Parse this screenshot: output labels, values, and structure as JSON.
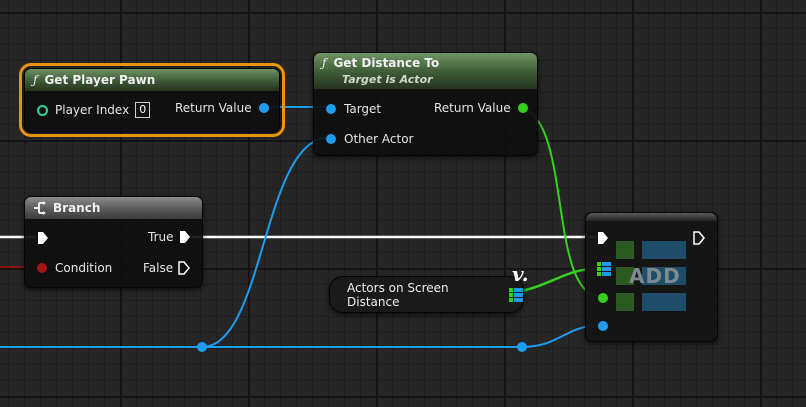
{
  "nodes": {
    "get_player_pawn": {
      "icon": "function-icon",
      "title": "Get Player Pawn",
      "input_label": "Player Index",
      "input_value": "0",
      "output_label": "Return Value"
    },
    "get_distance_to": {
      "icon": "function-icon",
      "title": "Get Distance To",
      "subtitle": "Target is Actor",
      "input_target": "Target",
      "input_other": "Other Actor",
      "output_label": "Return Value"
    },
    "branch": {
      "icon": "branch-icon",
      "title": "Branch",
      "input_condition": "Condition",
      "output_true": "True",
      "output_false": "False"
    },
    "variable": {
      "label": "Actors on Screen Distance",
      "badge": "v."
    },
    "add": {
      "label": "ADD"
    }
  },
  "colors": {
    "object_pin": "#1e9cf0",
    "float_pin": "#34d01c",
    "bool_pin": "#a31616",
    "exec_wire": "#ffffff",
    "selection": "#e8940f",
    "pure_header": "#4a6b40"
  }
}
